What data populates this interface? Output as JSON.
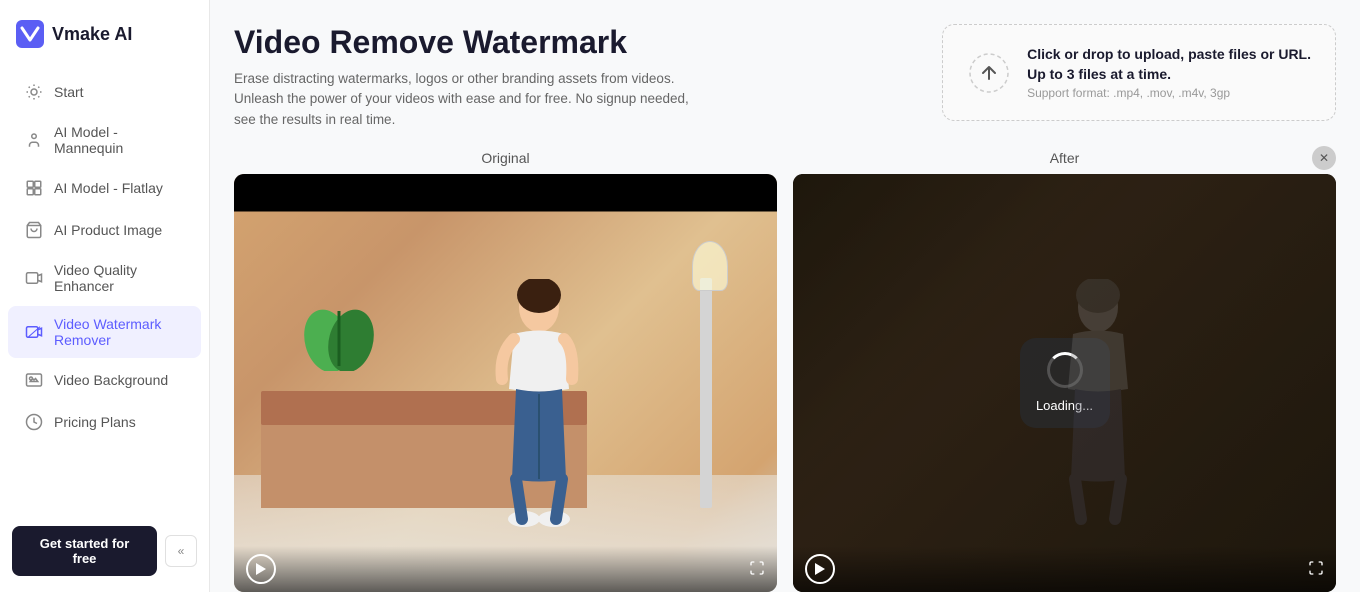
{
  "sidebar": {
    "logo": {
      "text": "Vmake AI"
    },
    "items": [
      {
        "id": "start",
        "label": "Start",
        "icon": "sun-icon",
        "active": false
      },
      {
        "id": "ai-model-mannequin",
        "label": "AI Model - Mannequin",
        "icon": "person-icon",
        "active": false
      },
      {
        "id": "ai-model-flatlay",
        "label": "AI Model - Flatlay",
        "icon": "layout-icon",
        "active": false
      },
      {
        "id": "ai-product-image",
        "label": "AI Product Image",
        "icon": "bag-icon",
        "active": false
      },
      {
        "id": "video-quality-enhancer",
        "label": "Video Quality Enhancer",
        "icon": "video-enhance-icon",
        "active": false
      },
      {
        "id": "video-watermark-remover",
        "label": "Video Watermark Remover",
        "icon": "video-wm-icon",
        "active": true
      },
      {
        "id": "video-background",
        "label": "Video Background",
        "icon": "video-bg-icon",
        "active": false
      },
      {
        "id": "pricing-plans",
        "label": "Pricing Plans",
        "icon": "pricing-icon",
        "active": false
      }
    ],
    "get_started_label": "Get started for free",
    "collapse_icon": "<<"
  },
  "header": {
    "title": "Video Remove Watermark",
    "description": "Erase distracting watermarks, logos or other branding assets from videos. Unleash the power of your videos with ease and for free. No signup needed, see the results in real time."
  },
  "upload": {
    "main_text": "Click or drop to upload, paste files or URL.\nUp to 3 files at a time.",
    "sub_text": "Support format: .mp4, .mov, .m4v, 3gp"
  },
  "panels": {
    "original_label": "Original",
    "after_label": "After",
    "loading_text": "Loading..."
  }
}
